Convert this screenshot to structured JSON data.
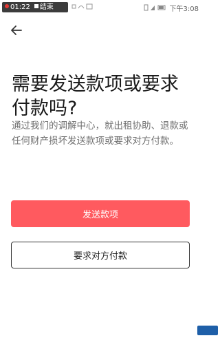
{
  "status_bar": {
    "recording_time": "01:22",
    "end_label": "结束",
    "right_text": "下午3:08"
  },
  "icons": {
    "back": "arrow-left-icon"
  },
  "content": {
    "title": "需要发送款项或要求付款吗?",
    "description": "通过我们的调解中心，就出租协助、退款或任何财产损坏发送款项或要求对方付款。"
  },
  "buttons": {
    "send_payment": "发送款项",
    "request_payment": "要求对方付款"
  },
  "colors": {
    "primary": "#ff5a5f",
    "text": "#1a1a1a",
    "secondary_text": "#6f6f6f"
  }
}
